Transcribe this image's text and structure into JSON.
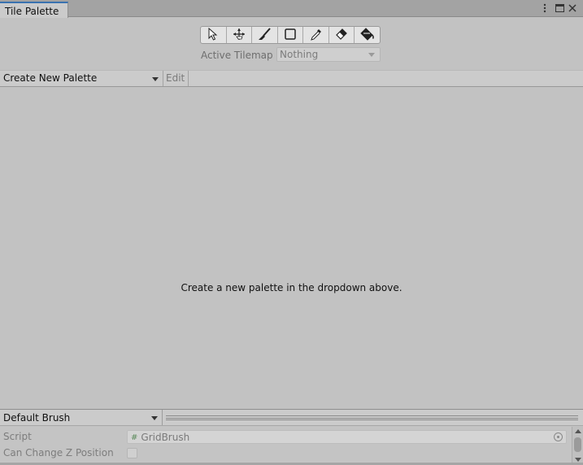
{
  "window": {
    "tab_title": "Tile Palette",
    "menu_icon": "kebab-menu-icon",
    "maximize_icon": "maximize-icon",
    "close_icon": "close-icon"
  },
  "toolbar": {
    "tools": [
      {
        "name": "select-tool",
        "icon": "arrow-cursor-icon"
      },
      {
        "name": "move-tool",
        "icon": "move-arrows-icon"
      },
      {
        "name": "paint-tool",
        "icon": "paintbrush-icon"
      },
      {
        "name": "box-fill-tool",
        "icon": "rectangle-icon"
      },
      {
        "name": "picker-tool",
        "icon": "eyedropper-icon"
      },
      {
        "name": "erase-tool",
        "icon": "eraser-icon"
      },
      {
        "name": "fill-tool",
        "icon": "paint-bucket-icon"
      }
    ],
    "active_tilemap_label": "Active Tilemap",
    "active_tilemap_value": "Nothing"
  },
  "palette": {
    "dropdown_value": "Create New Palette",
    "edit_label": "Edit",
    "empty_message": "Create a new palette in the dropdown above."
  },
  "brush": {
    "dropdown_value": "Default Brush"
  },
  "inspector": {
    "script_label": "Script",
    "script_value": "GridBrush",
    "z_label": "Can Change Z Position",
    "z_checked": false
  }
}
